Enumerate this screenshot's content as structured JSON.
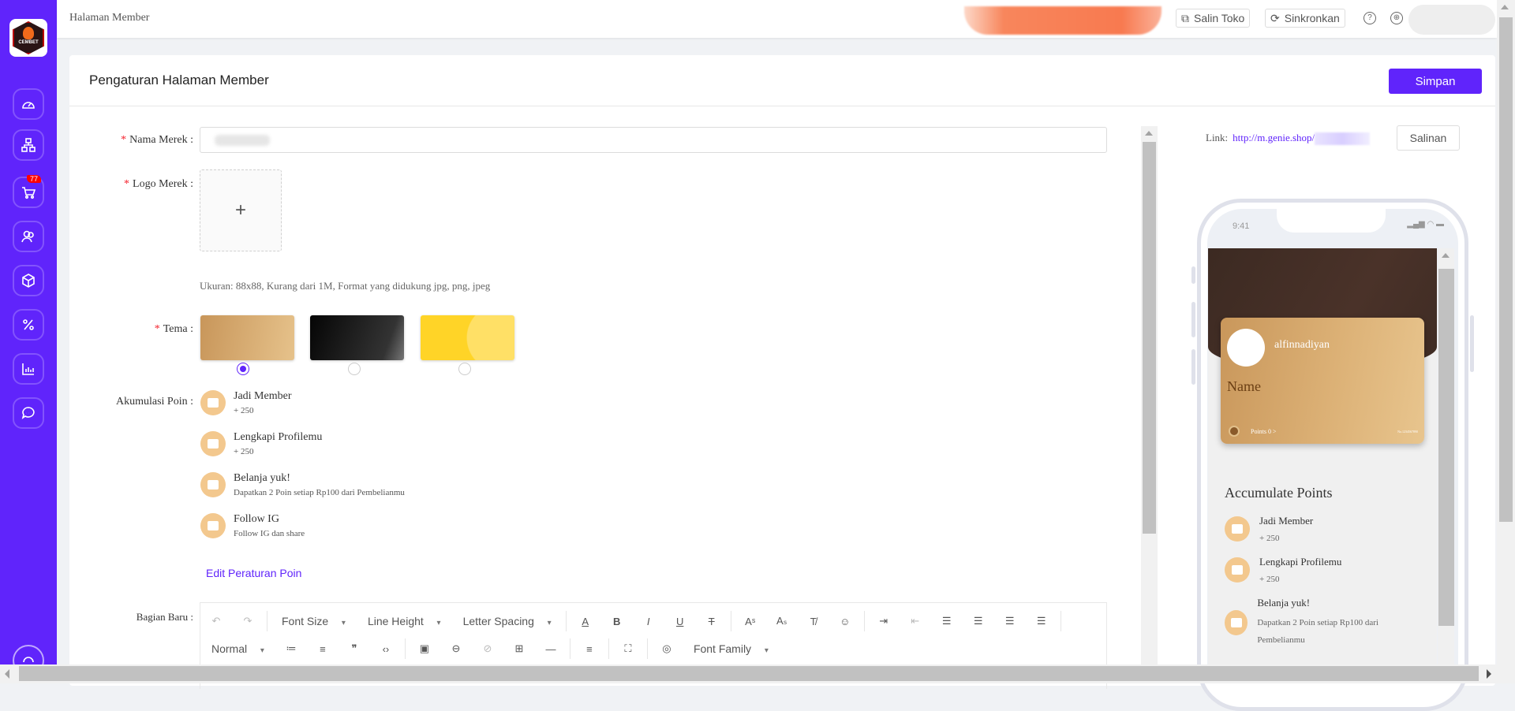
{
  "sidebar": {
    "logo_text": "CEMBET",
    "items": [
      {
        "icon": "dashboard-icon"
      },
      {
        "icon": "hierarchy-icon"
      },
      {
        "icon": "cart-icon",
        "badge": "77"
      },
      {
        "icon": "users-icon"
      },
      {
        "icon": "box-icon"
      },
      {
        "icon": "percent-icon"
      },
      {
        "icon": "chart-icon"
      },
      {
        "icon": "chat-icon"
      }
    ],
    "support_icon": "headset-icon"
  },
  "header": {
    "breadcrumb": "Halaman Member",
    "copy_store": "Salin Toko",
    "sync": "Sinkronkan",
    "help_icon": "?"
  },
  "page": {
    "title": "Pengaturan Halaman Member",
    "save": "Simpan",
    "accent": "#6024fb"
  },
  "form": {
    "brand_name_label": "Nama Merek :",
    "brand_name_value": "",
    "logo_label": "Logo Merek :",
    "upload_plus": "+",
    "logo_hint": "Ukuran: 88x88, Kurang dari 1M, Format yang didukung jpg, png, jpeg",
    "theme_label": "Tema :",
    "themes": [
      {
        "name": "gold",
        "selected": true
      },
      {
        "name": "black",
        "selected": false
      },
      {
        "name": "yellow",
        "selected": false
      }
    ],
    "points_label": "Akumulasi Poin :",
    "points": [
      {
        "title": "Jadi Member",
        "sub": "+ 250",
        "icon": "member-card-icon"
      },
      {
        "title": "Lengkapi Profilemu",
        "sub": "+ 250",
        "icon": "clipboard-edit-icon"
      },
      {
        "title": "Belanja yuk!",
        "sub": "Dapatkan 2 Poin setiap Rp100 dari Pembelianmu",
        "icon": "store-icon"
      },
      {
        "title": "Follow IG",
        "sub": "Follow IG dan share",
        "icon": "gift-icon"
      }
    ],
    "edit_rules": "Edit Peraturan Poin",
    "section_label": "Bagian Baru :",
    "toolbar": {
      "font_size": "Font Size",
      "line_height": "Line Height",
      "letter_spacing": "Letter Spacing",
      "normal": "Normal",
      "font_family": "Font Family"
    }
  },
  "preview": {
    "link_label": "Link:",
    "link_url": "http://m.genie.shop/",
    "copy": "Salinan",
    "time": "9:41",
    "username": "alfinnadiyan",
    "card_name": "Name",
    "points": "Points 0 >",
    "card_no": "No.1234567890",
    "accumulate_title": "Accumulate Points",
    "items": [
      {
        "title": "Jadi Member",
        "sub": "+ 250"
      },
      {
        "title": "Lengkapi Profilemu",
        "sub": "+ 250"
      },
      {
        "title": "Belanja yuk!",
        "sub": "Dapatkan 2 Poin setiap Rp100 dari Pembelianmu"
      }
    ]
  }
}
